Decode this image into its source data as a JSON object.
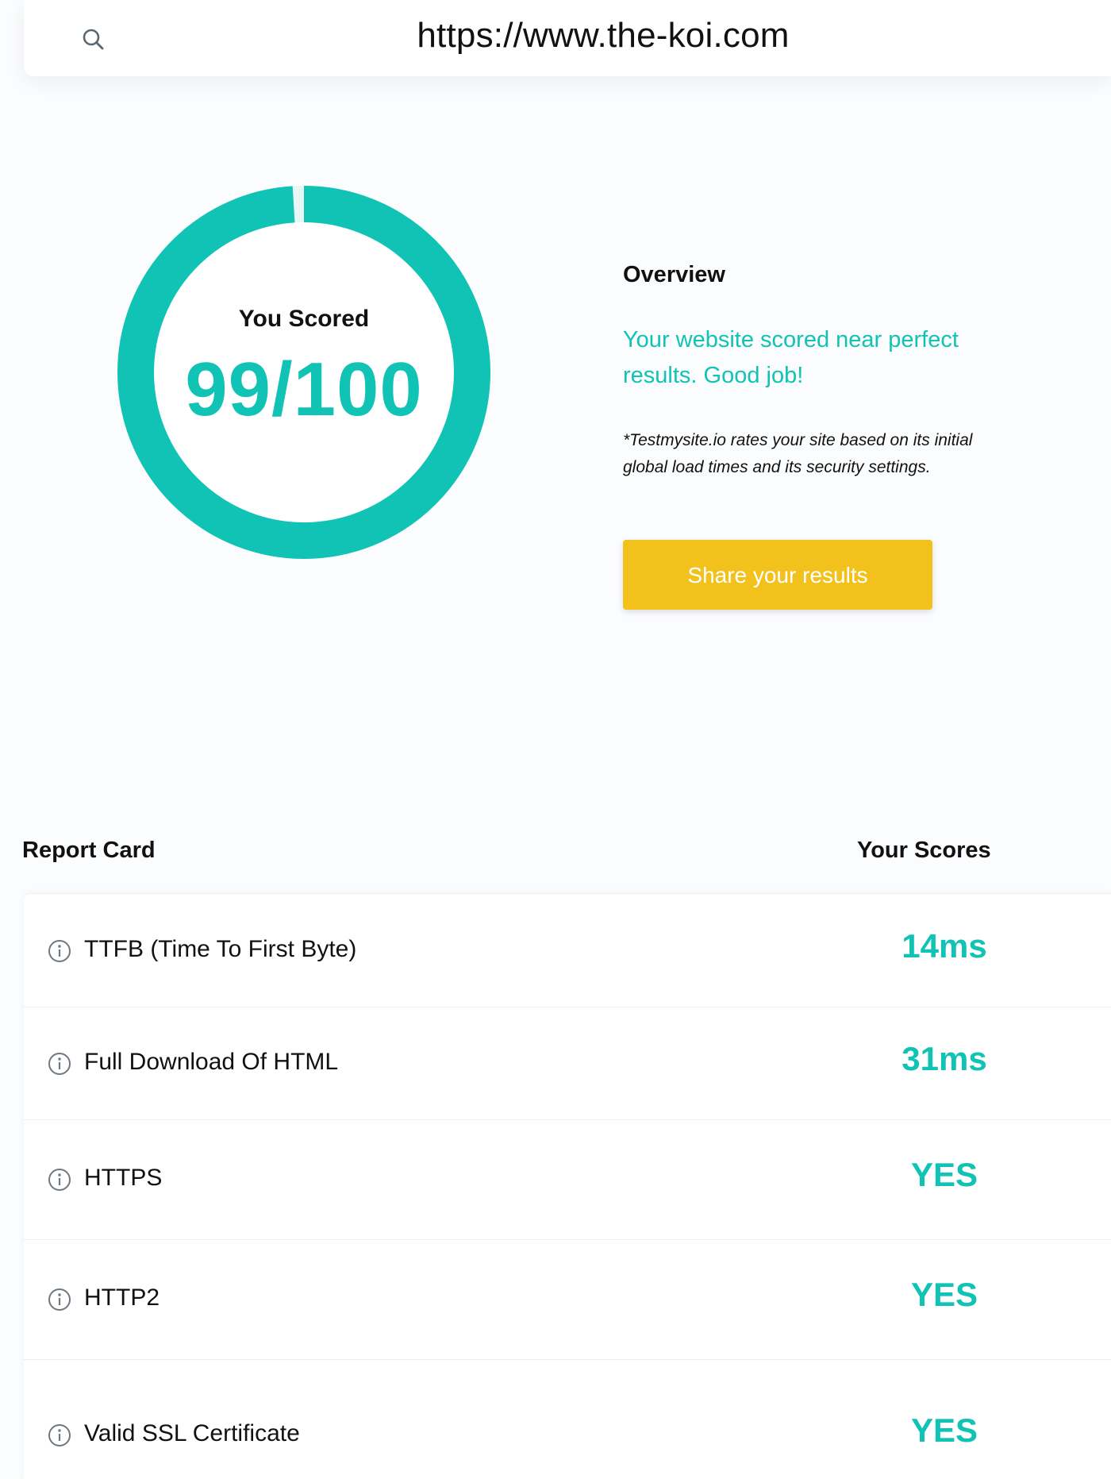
{
  "search": {
    "icon": "search-icon",
    "url": "https://www.the-koi.com"
  },
  "score": {
    "label": "You Scored",
    "value": "99/100",
    "fraction": 0.99,
    "ring_color": "#10c3b4"
  },
  "overview": {
    "title": "Overview",
    "message": "Your website scored near perfect results. Good job!",
    "note": "*Testmysite.io rates your site based on its initial global load times and its security settings.",
    "share_label": "Share your results",
    "share_color": "#f2c11b"
  },
  "report": {
    "title": "Report Card",
    "scores_title": "Your Scores",
    "rows": [
      {
        "label": "TTFB (Time To First Byte)",
        "score": "14ms",
        "icon": "info-icon"
      },
      {
        "label": "Full Download Of HTML",
        "score": "31ms",
        "icon": "info-icon"
      },
      {
        "label": "HTTPS",
        "score": "YES",
        "icon": "info-icon"
      },
      {
        "label": "HTTP2",
        "score": "YES",
        "icon": "info-icon"
      },
      {
        "label": "Valid SSL Certificate",
        "score": "YES",
        "icon": "info-icon"
      }
    ]
  }
}
